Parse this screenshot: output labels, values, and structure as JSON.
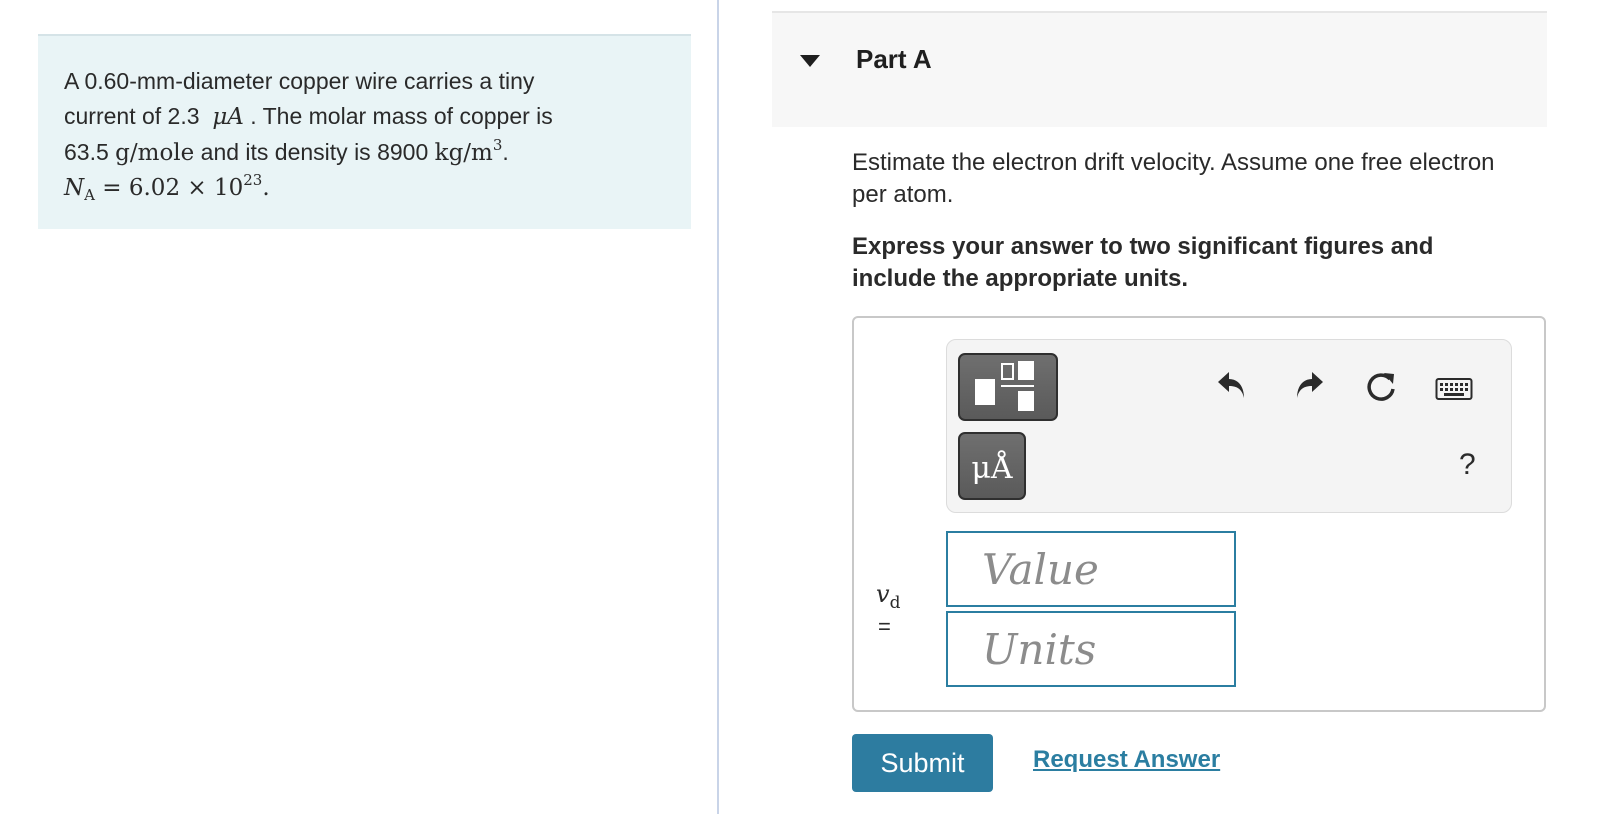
{
  "problem": {
    "line1": "A 0.60-mm-diameter copper wire carries a tiny",
    "line2_pre": "current of 2.3",
    "current_unit": "μA",
    "line2_post": ". The molar mass of copper is",
    "line3_value": "63.5",
    "molar_unit": "g/mole",
    "line3_mid": "and its density is 8900",
    "density_unit": "kg/m",
    "density_exp": "3",
    "line3_end": ".",
    "avogadro_symbol": "N",
    "avogadro_sub": "A",
    "avogadro_rhs": "= 6.02 × 10",
    "avogadro_exp": "23",
    "avogadro_end": "."
  },
  "part": {
    "title": "Part A",
    "question": "Estimate the electron drift velocity. Assume one free electron per atom.",
    "instruction": "Express your answer to two significant figures and include the appropriate units."
  },
  "toolbar": {
    "unit_button_label": "μÅ",
    "help_label": "?"
  },
  "answer": {
    "variable": "v",
    "variable_sub": "d",
    "equals": "=",
    "value_placeholder": "Value",
    "units_placeholder": "Units"
  },
  "actions": {
    "submit_label": "Submit",
    "request_label": "Request Answer"
  },
  "colors": {
    "problem_bg": "#e9f4f6",
    "accent": "#2d7ca0",
    "link": "#2b7ea1"
  }
}
